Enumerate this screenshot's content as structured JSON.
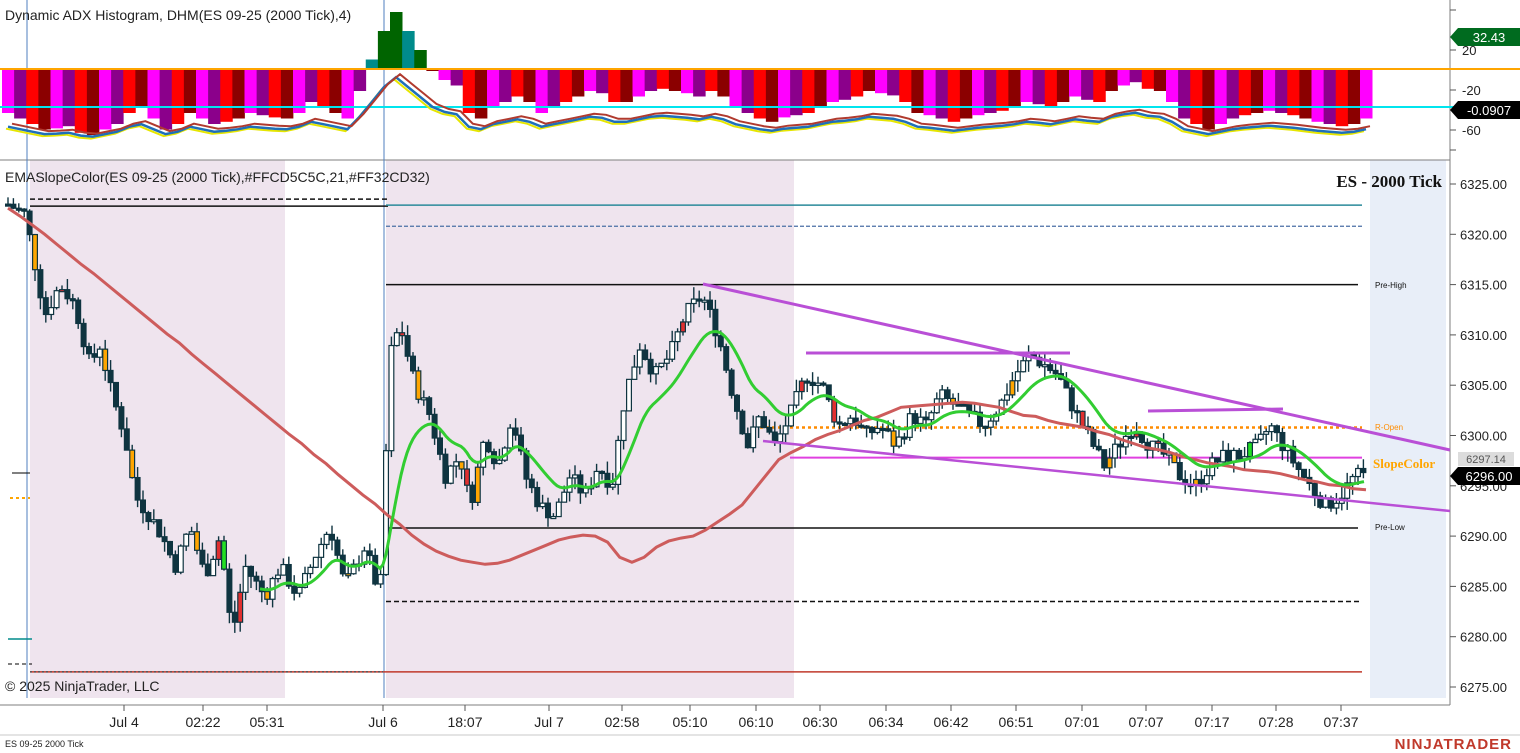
{
  "top_panel": {
    "indicator_title": "Dynamic ADX Histogram, DHM(ES 09-25 (2000 Tick),4)",
    "y_ticks": [
      "20",
      "-20",
      "-60"
    ],
    "value_badge_1": "32.43",
    "value_badge_2": "-0.0907"
  },
  "main_panel": {
    "indicator_title": "EMASlopeColor(ES 09-25 (2000 Tick),#FFCD5C5C,21,#FF32CD32)",
    "instrument_label": "ES - 2000 Tick",
    "price_ticks": [
      "6325.00",
      "6320.00",
      "6315.00",
      "6310.00",
      "6305.00",
      "6300.00",
      "6295.00",
      "6290.00",
      "6285.00",
      "6280.00",
      "6275.00"
    ],
    "last_price_badge": "6296.00",
    "hidden_badge": "6297.14",
    "pre_high_label": "Pre-High",
    "r_open_label": "R-Open",
    "pre_low_label": "Pre-Low",
    "slope_label": "SlopeColor",
    "copyright": "© 2025 NinjaTrader, LLC"
  },
  "x_axis": {
    "time_labels": [
      "Jul 4",
      "02:22",
      "05:31",
      "Jul 6",
      "18:07",
      "Jul 7",
      "02:58",
      "05:10",
      "06:10",
      "06:30",
      "06:34",
      "06:42",
      "06:51",
      "07:01",
      "07:07",
      "07:17",
      "07:28",
      "07:37"
    ]
  },
  "footer": {
    "series_label": "ES 09-25 2000 Tick",
    "brand": "NINJATRADER"
  },
  "colors": {
    "bull_candle_fill": "#ffffff",
    "bear_candle_fill": "#0f3440",
    "candle_outline": "#0f3440",
    "ema_fast": "#32cd32",
    "ema_slow": "#cd5c5c",
    "hist_magenta": "#ff00ff",
    "hist_purple": "#8b008b",
    "hist_red": "#ff0000",
    "hist_darkred": "#8b0000",
    "hist_green": "#006400",
    "hist_teal": "#008b8b",
    "hist_cyan": "#00ffff",
    "trend_line": "#b94fd6",
    "orange_highlight": "#ffa500",
    "session_shade": "#efe4ee"
  },
  "chart_data": {
    "type": "candlestick",
    "series": [
      {
        "name": "EMASlopeColor",
        "values": [
          6322.6,
          6321.8,
          6320.9,
          6320.0,
          6319.0,
          6318.0,
          6317.0,
          6316.1,
          6315.1,
          6314.1,
          6313.1,
          6312.1,
          6311.1,
          6310.1,
          6309.2,
          6308.1,
          6307.1,
          6306.1,
          6305.1,
          6304.1,
          6303.1,
          6302.1,
          6301.1,
          6300.1,
          6299.2,
          6298.1,
          6297.2,
          6296.1,
          6295.1,
          6294.1,
          6293.2,
          6292.1,
          6291.2,
          6290.1,
          6289.2,
          6288.5,
          6288.0,
          6287.6,
          6287.4,
          6287.2,
          6287.3,
          6287.6,
          6288.1,
          6288.6,
          6289.1,
          6289.6,
          6289.9,
          6290.1,
          6290.0,
          6289.4,
          6287.9,
          6287.4,
          6287.9,
          6288.9,
          6289.5,
          6289.8,
          6290.0,
          6290.6,
          6291.4,
          6292.2,
          6293.1,
          6294.6,
          6296.1,
          6297.6,
          6298.3,
          6298.9,
          6299.6,
          6300.1,
          6300.5,
          6301.0,
          6301.5,
          6301.8,
          6302.3,
          6302.8,
          6302.9,
          6303.0,
          6303.1,
          6303.2,
          6303.3,
          6303.2,
          6303.0,
          6302.8,
          6302.4,
          6302.0,
          6301.9,
          6301.5,
          6301.2,
          6301.0,
          6300.8,
          6300.4,
          6300.1,
          6299.6,
          6299.2,
          6298.8,
          6298.6,
          6298.3,
          6297.9,
          6297.6,
          6297.3,
          6297.1,
          6296.9,
          6296.6,
          6296.5,
          6296.4,
          6296.2,
          6295.9,
          6295.6,
          6295.4,
          6295.1,
          6295.0,
          6294.7,
          6294.6
        ]
      },
      {
        "name": "DHM",
        "values": [
          -40,
          -45,
          -50,
          -55,
          -54,
          -52,
          -58,
          -60,
          -55,
          -50,
          -40,
          -35,
          -45,
          -55,
          -50,
          -40,
          -45,
          -50,
          -48,
          -45,
          -40,
          -42,
          -44,
          -45,
          -40,
          -30,
          -35,
          -40,
          -45,
          -20,
          10,
          40,
          60,
          40,
          20,
          0,
          -10,
          -15,
          -40,
          -45,
          -35,
          -30,
          -25,
          -30,
          -40,
          -35,
          -30,
          -25,
          -20,
          -22,
          -30,
          -30,
          -25,
          -20,
          -18,
          -20,
          -22,
          -25,
          -20,
          -25,
          -35,
          -40,
          -45,
          -48,
          -44,
          -42,
          -40,
          -35,
          -30,
          -28,
          -25,
          -20,
          -22,
          -24,
          -30,
          -40,
          -42,
          -45,
          -48,
          -45,
          -42,
          -40,
          -38,
          -35,
          -30,
          -32,
          -35,
          -30,
          -25,
          -28,
          -30,
          -20,
          -15,
          -12,
          -18,
          -20,
          -30,
          -45,
          -50,
          -55,
          -50,
          -45,
          -42,
          -40,
          -38,
          -40,
          -42,
          -45,
          -48,
          -50,
          -52,
          -50,
          -45
        ]
      }
    ],
    "ylim": [
      6273.0,
      6327.5
    ],
    "yticks": [
      6325,
      6320,
      6315,
      6310,
      6305,
      6300,
      6295,
      6290,
      6285,
      6280,
      6275
    ],
    "reference_lines": {
      "pre_high": 6315.0,
      "r_open": 6300.8,
      "pre_low": 6290.8,
      "upper_blue": 6322.9,
      "upper_dashed_blue": 6320.8,
      "prior_upper_black": 6322.8,
      "prior_dashed_black": 6323.5,
      "prior_low_dashed": 6283.5,
      "red_support": 6276.5,
      "magenta_mid": 6297.8
    },
    "grid": false,
    "legend": "top-left"
  }
}
